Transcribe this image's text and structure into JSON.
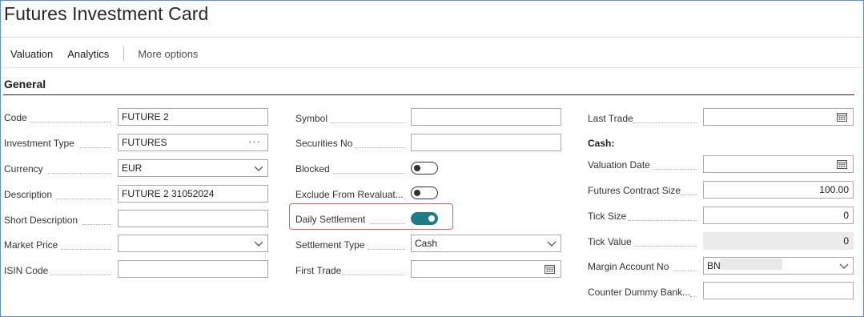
{
  "page": {
    "title": "Futures Investment Card"
  },
  "actions": {
    "valuation": "Valuation",
    "analytics": "Analytics",
    "more": "More options"
  },
  "section": {
    "general": "General",
    "cash": "Cash:"
  },
  "col1": {
    "code": {
      "label": "Code",
      "value": "FUTURE 2"
    },
    "investment_type": {
      "label": "Investment Type",
      "value": "FUTURES"
    },
    "currency": {
      "label": "Currency",
      "value": "EUR"
    },
    "description": {
      "label": "Description",
      "value": "FUTURE 2 31052024"
    },
    "short_description": {
      "label": "Short Description",
      "value": ""
    },
    "market_price": {
      "label": "Market Price",
      "value": ""
    },
    "isin_code": {
      "label": "ISIN Code",
      "value": ""
    }
  },
  "col2": {
    "symbol": {
      "label": "Symbol",
      "value": ""
    },
    "securities_no": {
      "label": "Securities No",
      "value": ""
    },
    "blocked": {
      "label": "Blocked",
      "on": false
    },
    "exclude_from_revaluation": {
      "label": "Exclude From Revaluat...",
      "on": false
    },
    "daily_settlement": {
      "label": "Daily Settlement",
      "on": true
    },
    "settlement_type": {
      "label": "Settlement Type",
      "value": "Cash"
    },
    "first_trade": {
      "label": "First Trade",
      "value": ""
    }
  },
  "col3": {
    "last_trade": {
      "label": "Last Trade",
      "value": ""
    },
    "valuation_date": {
      "label": "Valuation Date",
      "value": ""
    },
    "futures_contract_size": {
      "label": "Futures Contract Size",
      "value": "100.00"
    },
    "tick_size": {
      "label": "Tick Size",
      "value": "0"
    },
    "tick_value": {
      "label": "Tick Value",
      "value": "0"
    },
    "margin_account_no": {
      "label": "Margin Account No",
      "value": "BN"
    },
    "counter_dummy_bank": {
      "label": "Counter Dummy Bank...",
      "value": ""
    }
  },
  "colors": {
    "accent_toggle": "#1d7d86",
    "highlight_border": "#e06060"
  }
}
